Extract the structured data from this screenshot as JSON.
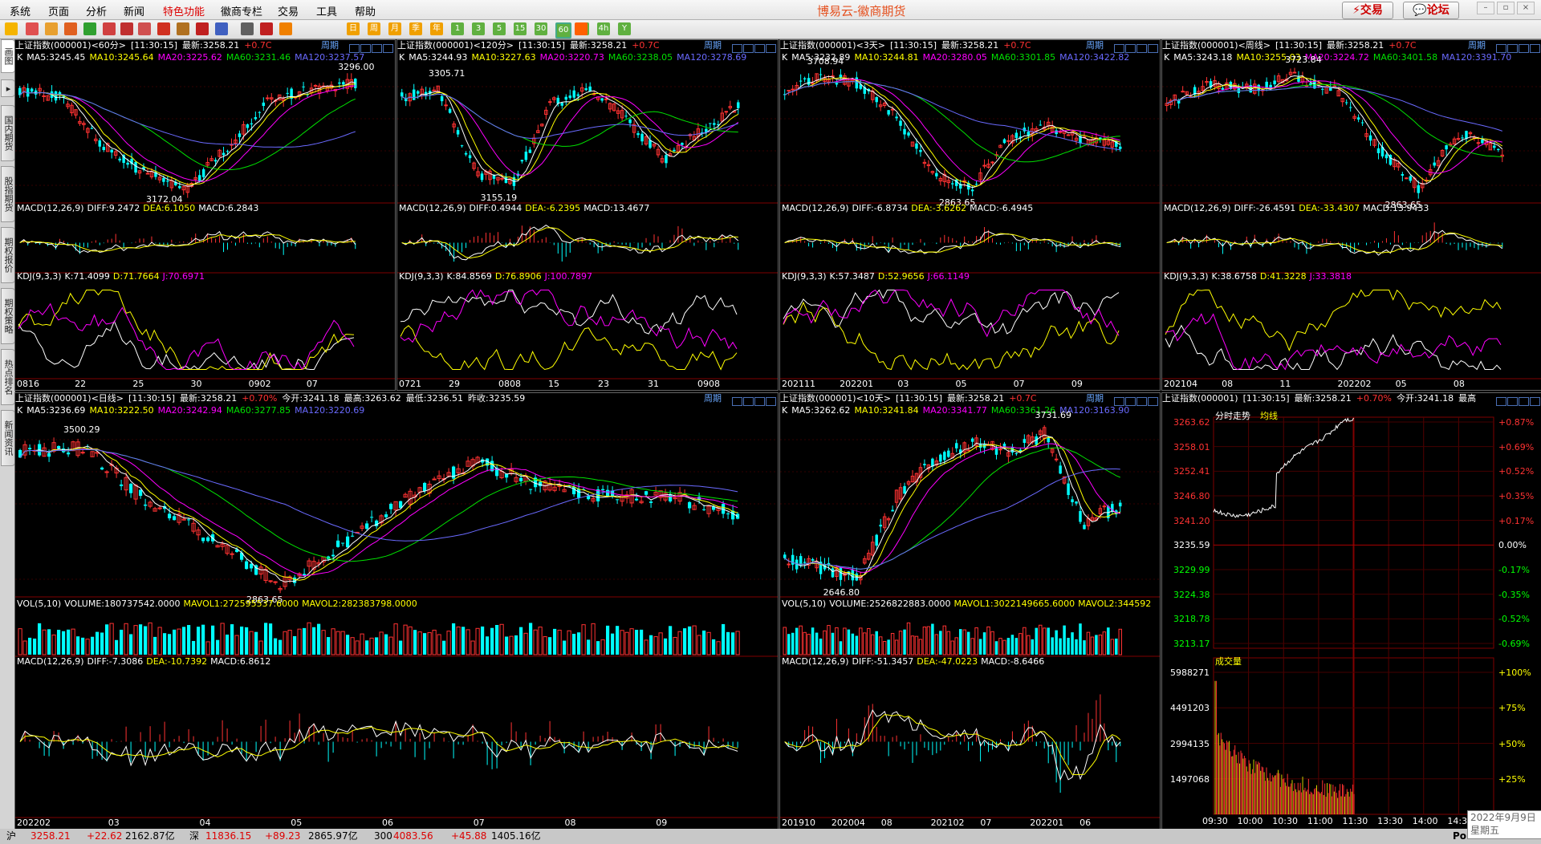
{
  "menu": {
    "items": [
      "系统",
      "页面",
      "分析",
      "新闻",
      "特色功能",
      "徽商专栏",
      "交易",
      "工具",
      "帮助"
    ],
    "title": "博易云-徽商期货",
    "trade_btn": "交易",
    "forum_btn": "论坛"
  },
  "toolbar": {
    "periods": [
      "日",
      "周",
      "月",
      "季",
      "年",
      "1",
      "3",
      "5",
      "15",
      "30",
      "60",
      "2h",
      "4h",
      "Y"
    ]
  },
  "sidetabs": [
    "画图",
    "国内期货",
    "股指期货",
    "期权报价",
    "期权策略",
    "热点排名",
    "新闻资讯"
  ],
  "colors": {
    "up": "#ff3232",
    "down": "#00ffff",
    "ma5": "#ffffff",
    "ma10": "#ffff00",
    "ma20": "#ff00ff",
    "ma60": "#00e000",
    "ma120": "#6a6aff",
    "bg": "#000000",
    "grid": "#800000",
    "label_up": "#ff3232",
    "label_down": "#00ff00"
  },
  "common": {
    "time": "[11:30:15]",
    "last": "最新:3258.21",
    "chg": "+0.7C",
    "chg_full": "+0.70%",
    "zq": "周期",
    "macd_title": "MACD(12,26,9)",
    "kdj_title": "KDJ(9,3,3)",
    "k": "K",
    "vol_title": "VOL(5,10)"
  },
  "p60": {
    "title": "上证指数(000001)<60分>",
    "ma": [
      "MA5:3245.45",
      "MA10:3245.64",
      "MA20:3225.62",
      "MA60:3231.46",
      "MA120:3237.57"
    ],
    "hi": "3296.00",
    "lo": "3172.04",
    "macd": [
      "DIFF:9.2472",
      "DEA:6.1050",
      "MACD:6.2843"
    ],
    "kdj": [
      "K:71.4099",
      "D:71.7664",
      "J:70.6971"
    ],
    "xlabels": [
      "0816",
      "22",
      "25",
      "30",
      "0902",
      "07"
    ]
  },
  "p120": {
    "title": "上证指数(000001)<120分>",
    "ma": [
      "MA5:3244.93",
      "MA10:3227.63",
      "MA20:3220.73",
      "MA60:3238.05",
      "MA120:3278.69"
    ],
    "hi": "3305.71",
    "lo": "3155.19",
    "macd": [
      "DIFF:0.4944",
      "DEA:-6.2395",
      "MACD:13.4677"
    ],
    "kdj": [
      "K:84.8569",
      "D:76.8906",
      "J:100.7897"
    ],
    "xlabels": [
      "0721",
      "29",
      "0808",
      "15",
      "23",
      "31",
      "0908"
    ]
  },
  "p3d": {
    "title": "上证指数(000001)<3天>",
    "ma": [
      "MA5:3232.89",
      "MA10:3244.81",
      "MA20:3280.05",
      "MA60:3301.85",
      "MA120:3422.82"
    ],
    "hi": "3708.94",
    "lo": "2863.65",
    "macd": [
      "DIFF:-6.8734",
      "DEA:-3.6262",
      "MACD:-6.4945"
    ],
    "kdj": [
      "K:57.3487",
      "D:52.9656",
      "J:66.1149"
    ],
    "xlabels": [
      "202111",
      "202201",
      "03",
      "05",
      "07",
      "09"
    ]
  },
  "pw": {
    "title": "上证指数(000001)<周线>",
    "ma": [
      "MA5:3243.18",
      "MA10:3255.03",
      "MA20:3224.72",
      "MA60:3401.58",
      "MA120:3391.70"
    ],
    "hi": "3723.84",
    "lo": "2863.65",
    "macd": [
      "DIFF:-26.4591",
      "DEA:-33.4307",
      "MACD:13.9433"
    ],
    "kdj": [
      "K:38.6758",
      "D:41.3228",
      "J:33.3818"
    ],
    "xlabels": [
      "202104",
      "08",
      "11",
      "202202",
      "05",
      "08"
    ]
  },
  "pd": {
    "title": "上证指数(000001)<日线>",
    "open": "今开:3241.18",
    "high": "最高:3263.62",
    "low": "最低:3236.51",
    "prev": "昨收:3235.59",
    "ma": [
      "MA5:3236.69",
      "MA10:3222.50",
      "MA20:3242.94",
      "MA60:3277.85",
      "MA120:3220.69"
    ],
    "hi": "3500.29",
    "lo": "2863.65",
    "vol": [
      "VOLUME:180737542.0000",
      "MAVOL1:272595537.6000",
      "MAVOL2:282383798.0000"
    ],
    "macd": [
      "DIFF:-7.3086",
      "DEA:-10.7392",
      "MACD:6.8612"
    ],
    "xlabels": [
      "202202",
      "03",
      "04",
      "05",
      "06",
      "07",
      "08",
      "09"
    ]
  },
  "p10d": {
    "title": "上证指数(000001)<10天>",
    "ma": [
      "MA5:3262.62",
      "MA10:3241.84",
      "MA20:3341.77",
      "MA60:3361.26",
      "MA120:3163.90"
    ],
    "hi": "3731.69",
    "lo": "2646.80",
    "vol": [
      "VOLUME:2526822883.0000",
      "MAVOL1:3022149665.6000",
      "MAVOL2:344592"
    ],
    "macd": [
      "DIFF:-51.3457",
      "DEA:-47.0223",
      "MACD:-8.6466"
    ],
    "xlabels": [
      "201910",
      "202004",
      "08",
      "202102",
      "07",
      "202201",
      "06"
    ]
  },
  "intraday": {
    "title": "上证指数(000001)",
    "open": "今开:3241.18",
    "high": "最高",
    "leg1": "分时走势",
    "leg2": "均线",
    "vol_label": "成交量",
    "prices": [
      "3263.62",
      "3258.01",
      "3252.41",
      "3246.80",
      "3241.20",
      "3235.59",
      "3229.99",
      "3224.38",
      "3218.78",
      "3213.17"
    ],
    "pcts": [
      "+0.87%",
      "+0.69%",
      "+0.52%",
      "+0.35%",
      "+0.17%",
      "0.00%",
      "-0.17%",
      "-0.35%",
      "-0.52%",
      "-0.69%"
    ],
    "vols": [
      "5988271",
      "4491203",
      "2994135",
      "1497068"
    ],
    "vpcts": [
      "+100%",
      "+75%",
      "+50%",
      "+25%"
    ],
    "times": [
      "09:30",
      "10:00",
      "10:30",
      "11:00",
      "11:30",
      "13:30",
      "14:00",
      "14:30"
    ]
  },
  "statusbar": {
    "sh": "沪",
    "sh_idx": "3258.21",
    "sh_chg": "+22.62",
    "sh_amt": "2162.87亿",
    "sz": "深",
    "sz_idx": "11836.15",
    "sz_chg": "+89.23",
    "sz_amt": "2865.97亿",
    "c300": "300",
    "c300_idx": "4083.56",
    "c300_chg": "+45.88",
    "c300_amt": "1405.16亿",
    "po": "Po"
  },
  "datebox": {
    "date": "2022年9月9日",
    "weekday": "星期五"
  }
}
